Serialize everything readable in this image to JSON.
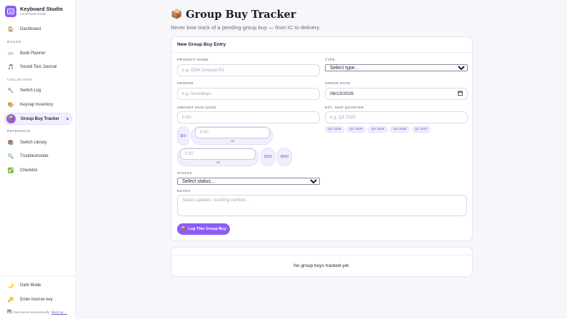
{
  "sidebar": {
    "brand": {
      "name": "Keyboard Studio",
      "domain": "contempt8.studio"
    },
    "sections": {
      "builds": "BUILDS",
      "collection": "COLLECTION",
      "reference": "REFERENCE"
    },
    "items": [
      {
        "label": "Dashboard",
        "icon": "house-icon"
      },
      {
        "label": "Build Planner",
        "icon": "keyboard-icon"
      },
      {
        "label": "Sound Test Journal",
        "icon": "music-note-icon"
      },
      {
        "label": "Switch Log",
        "icon": "wrench-icon"
      },
      {
        "label": "Keycap Inventory",
        "icon": "palette-icon"
      },
      {
        "label": "Group Buy Tracker",
        "icon": "package-icon"
      },
      {
        "label": "Switch Library",
        "icon": "books-icon"
      },
      {
        "label": "Troubleshooter",
        "icon": "magnifier-icon"
      },
      {
        "label": "Checklist",
        "icon": "check-box-icon"
      }
    ],
    "bottom": [
      {
        "label": "Dark Mode",
        "icon": "moon-icon"
      },
      {
        "label": "Enter license key",
        "icon": "key-icon"
      }
    ],
    "footer": {
      "text": "Data saves automatically.",
      "link": "Back up ..."
    }
  },
  "page": {
    "title": "Group Buy Tracker",
    "title_icon": "package-icon",
    "subtitle": "Never lose track of a pending group buy — from IC to delivery."
  },
  "form": {
    "header": "New Group Buy Entry",
    "product_name": {
      "label": "PRODUCT NAME",
      "placeholder": "e.g. GMK Dracula R2"
    },
    "type": {
      "label": "TYPE",
      "value": "Select type..."
    },
    "vendor": {
      "label": "VENDOR",
      "placeholder": "e.g. Novelkeys"
    },
    "order_date": {
      "label": "ORDER DATE",
      "value": "06/13/2026"
    },
    "amount": {
      "label": "AMOUNT PAID (USD)",
      "placeholder": "0.00"
    },
    "ship_quarter": {
      "label": "EST. SHIP QUARTER",
      "placeholder": "e.g. Q3 2025",
      "options": [
        "Q1 2026",
        "Q2 2026",
        "Q3 2026",
        "Q4 2026",
        "Q1 2027"
      ]
    },
    "quick_amounts": {
      "row1_button": "$50",
      "row1_input_placeholder": "0.00",
      "row1_value": "00",
      "row2_input_placeholder": "0.00",
      "row2_value": "50",
      "buttons": [
        "$250",
        "$400"
      ]
    },
    "status": {
      "label": "STATUS",
      "value": "Select status..."
    },
    "notes": {
      "label": "NOTES",
      "placeholder": "Status updates, tracking number..."
    },
    "submit": {
      "label": "Log This Group Buy",
      "icon": "package-icon"
    }
  },
  "list": {
    "empty": "No group buys tracked yet."
  },
  "colors": {
    "accent": "#8b5cf6",
    "accent_soft": "#f3eefe",
    "background": "#f7f6fb"
  }
}
